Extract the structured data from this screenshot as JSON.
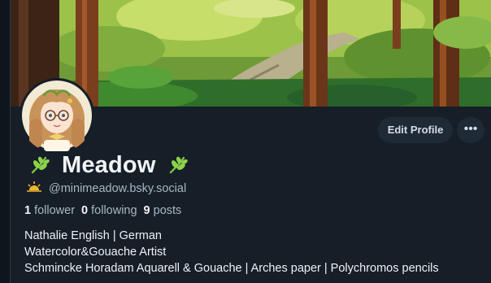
{
  "profile": {
    "display_name": "Meadow",
    "handle": "@minimeadow.bsky.social",
    "stats": {
      "followers_count": "1",
      "followers_label": "follower",
      "following_count": "0",
      "following_label": "following",
      "posts_count": "9",
      "posts_label": "posts"
    },
    "bio": [
      "Nathalie English | German",
      "Watercolor&Gouache Artist",
      "Schmincke Horadam Aquarell & Gouache | Arches paper | Polychromos pencils"
    ]
  },
  "actions": {
    "edit_profile_label": "Edit Profile",
    "more_label": "•••"
  },
  "icons": {
    "name_left": "leaf-icon",
    "name_right": "leaf-icon",
    "handle": "sunrise-icon",
    "more": "ellipsis-icon"
  },
  "colors": {
    "background": "#161e27",
    "button_bg": "#1f2a37",
    "text_primary": "#f1f4f8",
    "text_secondary": "#aab6c5"
  }
}
